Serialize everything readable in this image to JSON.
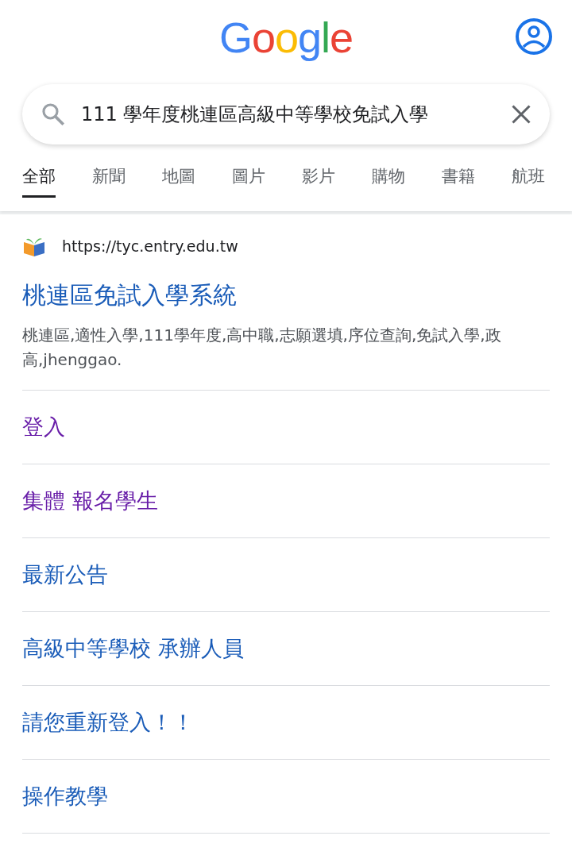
{
  "logo": "Google",
  "search": {
    "value": "111 學年度桃連區高級中等學校免試入學"
  },
  "tabs": [
    {
      "label": "全部",
      "selected": true
    },
    {
      "label": "新聞",
      "selected": false
    },
    {
      "label": "地圖",
      "selected": false
    },
    {
      "label": "圖片",
      "selected": false
    },
    {
      "label": "影片",
      "selected": false
    },
    {
      "label": "購物",
      "selected": false
    },
    {
      "label": "書籍",
      "selected": false
    },
    {
      "label": "航班",
      "selected": false
    }
  ],
  "result": {
    "url": "https://tyc.entry.edu.tw",
    "title": "桃連區免試入學系統",
    "snippet": "桃連區,適性入學,111學年度,高中職,志願選填,序位查詢,免試入學,政高,jhenggao.",
    "sitelinks": [
      {
        "label": "登入",
        "visited": true
      },
      {
        "label": "集體 報名學生",
        "visited": true
      },
      {
        "label": "最新公告",
        "visited": false
      },
      {
        "label": "高級中等學校 承辦人員",
        "visited": false
      },
      {
        "label": "請您重新登入！！",
        "visited": false
      },
      {
        "label": "操作教學",
        "visited": false
      }
    ]
  }
}
